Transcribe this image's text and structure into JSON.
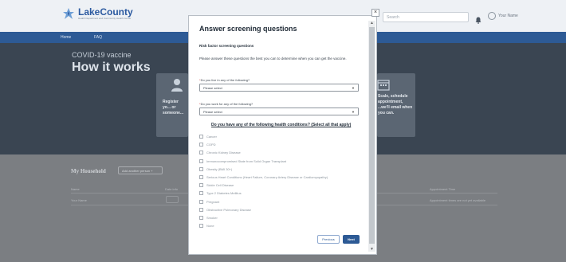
{
  "header": {
    "logo_name": "LakeCounty",
    "logo_sub": "Health Department and Community Health Center",
    "search_placeholder": "Search",
    "user_label": "Your Name"
  },
  "nav": {
    "items": [
      "Home",
      "FAQ"
    ]
  },
  "hero": {
    "subtitle": "COVID-19 vaccine",
    "title": "How it works",
    "card_left_text": "Register yo... or someone...",
    "card_right_text": "Scale, schedule appointment, ...we'll email when you can."
  },
  "household": {
    "title": "My Household",
    "add_button": "Add another person +",
    "columns": [
      "Name",
      "Date info",
      "Appointment Time"
    ],
    "row": {
      "name": "Your Name",
      "appointment": "Appointment times are not yet available"
    }
  },
  "modal": {
    "title": "Answer screening questions",
    "section_title": "Risk factor screening questions",
    "intro": "Please answer these questions the best you can to determine when you can get the vaccine.",
    "q1_label": "Do you live in any of the following?",
    "q1_value": "Please select",
    "q2_label": "Do you work for any of the following?",
    "q2_value": "Please select",
    "conditions_heading": "Do you have any of the following health conditions? (Select all that apply)",
    "conditions": [
      "Cancer",
      "COPD",
      "Chronic Kidney Disease",
      "Immunocompromised State from Solid Organ Transplant",
      "Obesity (BMI 30+)",
      "Serious Heart Conditions (Heart Failure, Coronary Artery Disease or Cardiomyopathy)",
      "Sickle Cell Disease",
      "Type 2 Diabetes Mellitus",
      "Pregnant",
      "Obstructive Pulmonary Disease",
      "Smoker",
      "None"
    ],
    "prev_label": "Previous",
    "next_label": "Next",
    "close_symbol": "×"
  },
  "colors": {
    "brand": "#2d5a95",
    "hero_bg": "#3a4552",
    "required": "#d23b3b"
  }
}
